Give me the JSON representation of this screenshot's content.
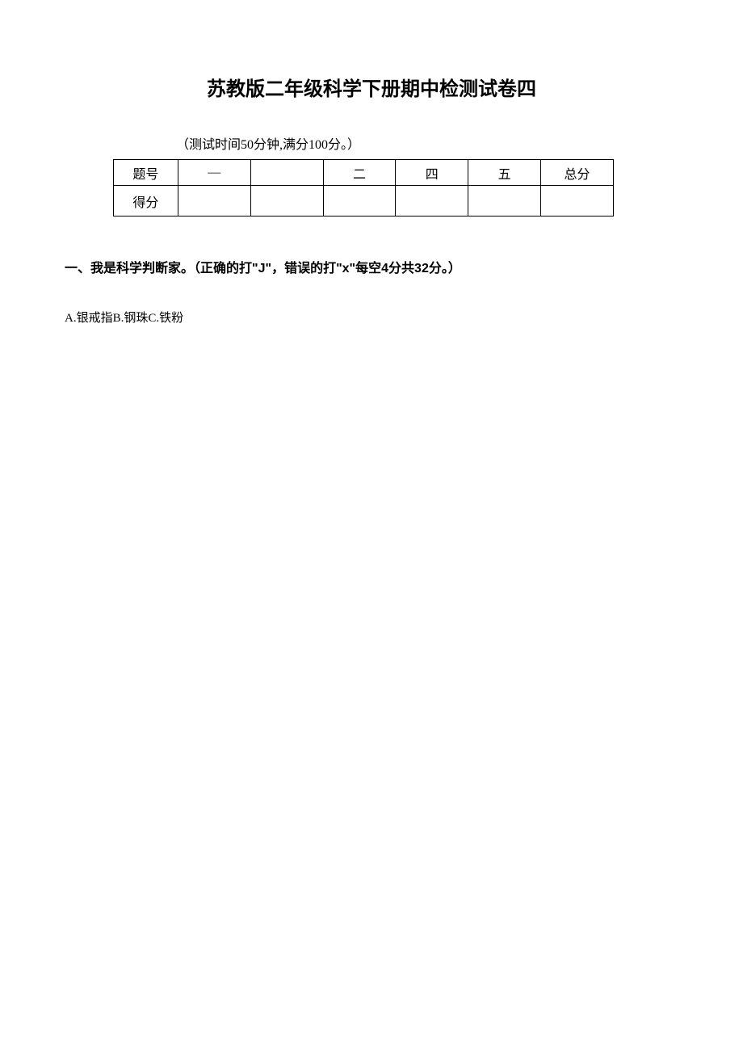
{
  "title": "苏教版二年级科学下册期中检测试卷四",
  "subtitle": "（测试时间50分钟,满分100分。）",
  "table": {
    "row1": {
      "label": "题号",
      "c1": "—",
      "c2": "",
      "c3": "二",
      "c4": "四",
      "c5": "五",
      "c6": "总分"
    },
    "row2": {
      "label": "得分",
      "c1": "",
      "c2": "",
      "c3": "",
      "c4": "",
      "c5": "",
      "c6": ""
    }
  },
  "section1": {
    "heading": "一、我是科学判断家。（正确的打\"J\"，错误的打\"x\"每空4分共32分。）",
    "question_a": "A.银戒指B.钢珠C.铁粉"
  }
}
